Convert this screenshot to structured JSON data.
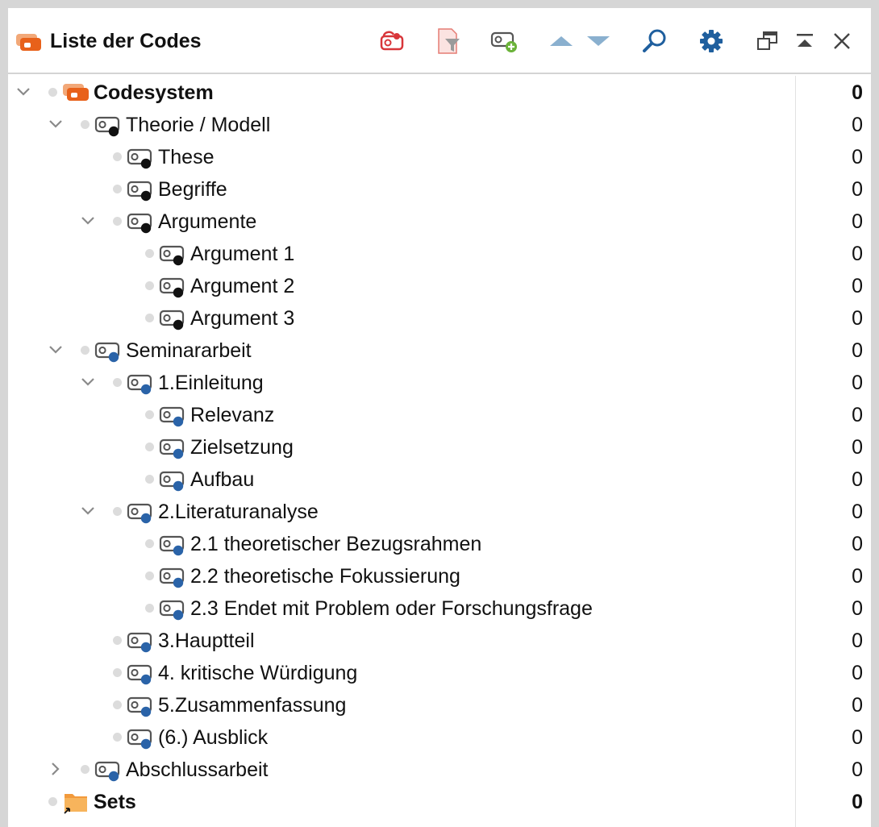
{
  "header": {
    "title": "Liste der Codes",
    "icons": [
      "code-system-icon",
      "codes-with-link-icon",
      "filter-icon",
      "new-code-icon",
      "move-up-icon",
      "move-down-icon",
      "search-icon",
      "settings-icon",
      "undock-window-icon",
      "collapse-panel-icon",
      "close-icon"
    ]
  },
  "colors": {
    "accent_orange": "#e8611a",
    "black_code": "#111111",
    "blue_code": "#2a63a8",
    "toolbar_blue": "#1f5f9e",
    "arrow_blue": "#8ab0cf"
  },
  "tree": [
    {
      "label": "Codesystem",
      "count": "0",
      "level": 0,
      "expand": "open",
      "icon": "codesystem",
      "bold": true
    },
    {
      "label": "Theorie / Modell",
      "count": "0",
      "level": 1,
      "expand": "open",
      "icon": "code",
      "color": "black"
    },
    {
      "label": "These",
      "count": "0",
      "level": 2,
      "expand": "none",
      "icon": "code",
      "color": "black"
    },
    {
      "label": "Begriffe",
      "count": "0",
      "level": 2,
      "expand": "none",
      "icon": "code",
      "color": "black"
    },
    {
      "label": "Argumente",
      "count": "0",
      "level": 2,
      "expand": "open",
      "icon": "code",
      "color": "black"
    },
    {
      "label": "Argument 1",
      "count": "0",
      "level": 3,
      "expand": "none",
      "icon": "code",
      "color": "black"
    },
    {
      "label": "Argument 2",
      "count": "0",
      "level": 3,
      "expand": "none",
      "icon": "code",
      "color": "black"
    },
    {
      "label": "Argument 3",
      "count": "0",
      "level": 3,
      "expand": "none",
      "icon": "code",
      "color": "black"
    },
    {
      "label": "Seminararbeit",
      "count": "0",
      "level": 1,
      "expand": "open",
      "icon": "code",
      "color": "blue"
    },
    {
      "label": "1.Einleitung",
      "count": "0",
      "level": 2,
      "expand": "open",
      "icon": "code",
      "color": "blue"
    },
    {
      "label": "Relevanz",
      "count": "0",
      "level": 3,
      "expand": "none",
      "icon": "code",
      "color": "blue"
    },
    {
      "label": "Zielsetzung",
      "count": "0",
      "level": 3,
      "expand": "none",
      "icon": "code",
      "color": "blue"
    },
    {
      "label": "Aufbau",
      "count": "0",
      "level": 3,
      "expand": "none",
      "icon": "code",
      "color": "blue"
    },
    {
      "label": "2.Literaturanalyse",
      "count": "0",
      "level": 2,
      "expand": "open",
      "icon": "code",
      "color": "blue"
    },
    {
      "label": "2.1 theoretischer Bezugsrahmen",
      "count": "0",
      "level": 3,
      "expand": "none",
      "icon": "code",
      "color": "blue"
    },
    {
      "label": "2.2 theoretische Fokussierung",
      "count": "0",
      "level": 3,
      "expand": "none",
      "icon": "code",
      "color": "blue"
    },
    {
      "label": "2.3 Endet mit Problem oder Forschungsfrage",
      "count": "0",
      "level": 3,
      "expand": "none",
      "icon": "code",
      "color": "blue"
    },
    {
      "label": "3.Hauptteil",
      "count": "0",
      "level": 2,
      "expand": "none",
      "icon": "code",
      "color": "blue"
    },
    {
      "label": "4. kritische Würdigung",
      "count": "0",
      "level": 2,
      "expand": "none",
      "icon": "code",
      "color": "blue"
    },
    {
      "label": "5.Zusammenfassung",
      "count": "0",
      "level": 2,
      "expand": "none",
      "icon": "code",
      "color": "blue"
    },
    {
      "label": "(6.) Ausblick",
      "count": "0",
      "level": 2,
      "expand": "none",
      "icon": "code",
      "color": "blue"
    },
    {
      "label": "Abschlussarbeit",
      "count": "0",
      "level": 1,
      "expand": "closed",
      "icon": "code",
      "color": "blue"
    },
    {
      "label": "Sets",
      "count": "0",
      "level": 0,
      "expand": "none",
      "icon": "sets",
      "bold": true
    }
  ]
}
